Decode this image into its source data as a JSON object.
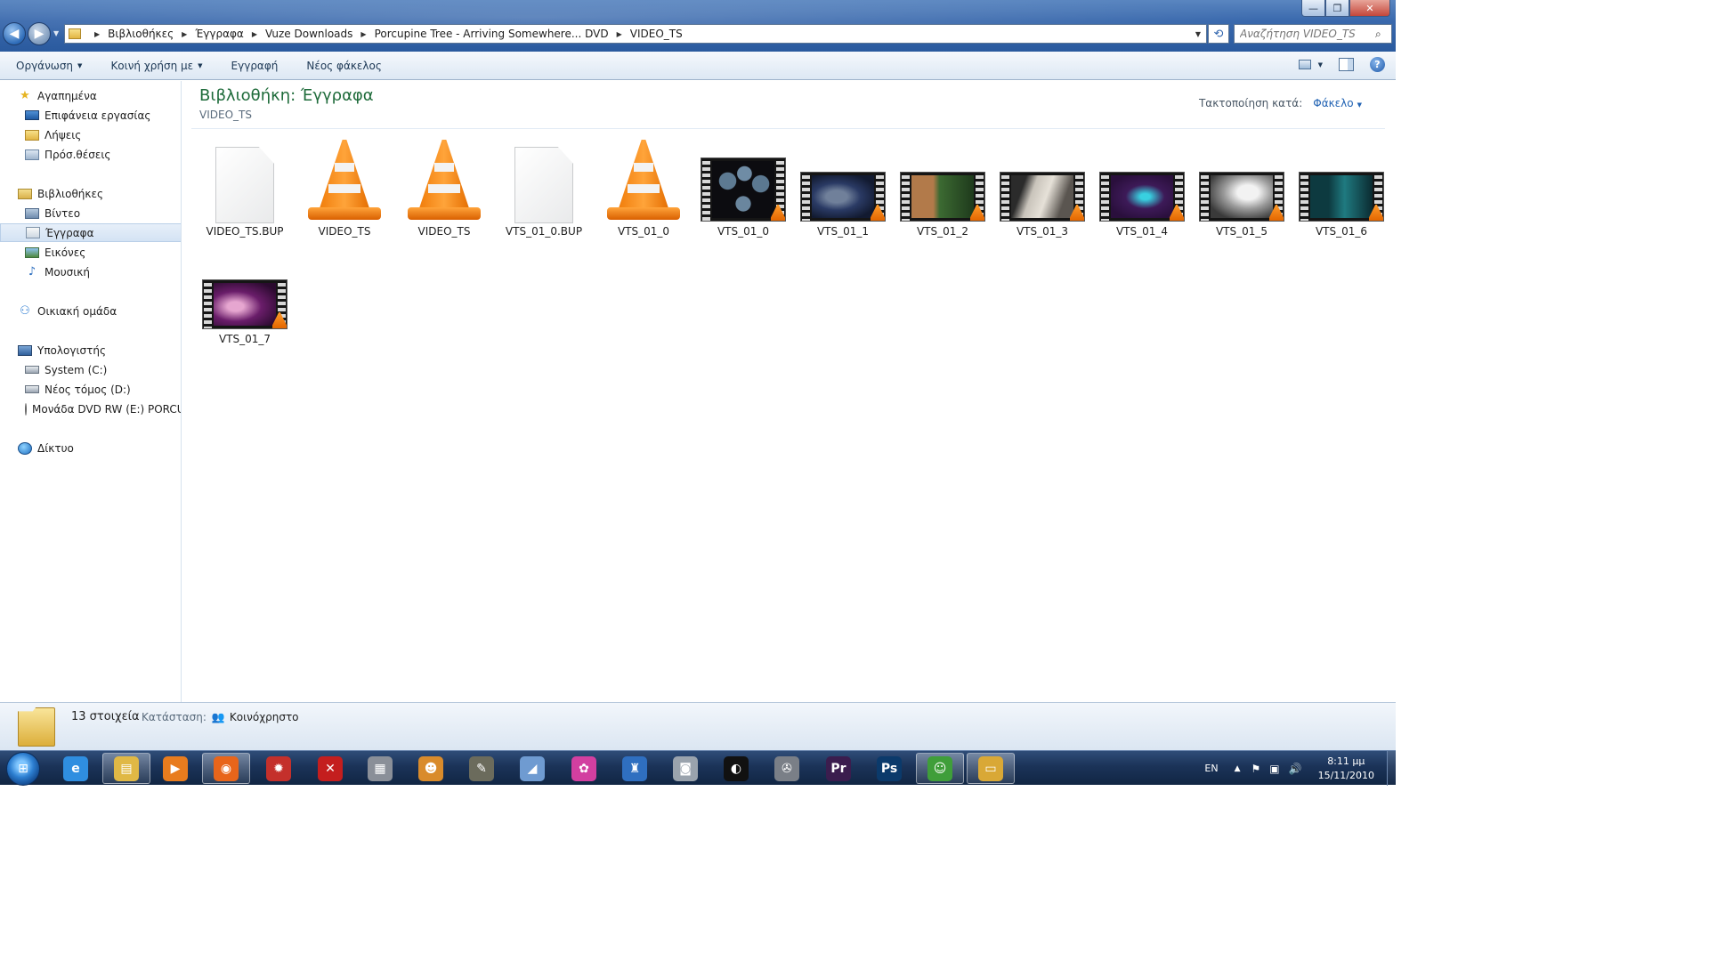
{
  "window": {
    "minimize_label": "—",
    "maximize_label": "❐",
    "close_label": "✕"
  },
  "address": {
    "crumbs": [
      "Βιβλιοθήκες",
      "Έγγραφα",
      "Vuze Downloads",
      "Porcupine Tree - Arriving Somewhere... DVD",
      "VIDEO_TS"
    ]
  },
  "search": {
    "placeholder": "Αναζήτηση VIDEO_TS"
  },
  "commandbar": {
    "organize": "Οργάνωση",
    "share_with": "Κοινή χρήση με",
    "burn": "Εγγραφή",
    "new_folder": "Νέος φάκελος"
  },
  "navpane": {
    "favorites": "Αγαπημένα",
    "desktop": "Επιφάνεια εργασίας",
    "downloads": "Λήψεις",
    "recent": "Πρόσ.θέσεις",
    "libraries": "Βιβλιοθήκες",
    "videos": "Βίντεο",
    "documents": "Έγγραφα",
    "pictures": "Εικόνες",
    "music": "Μουσική",
    "homegroup": "Οικιακή ομάδα",
    "computer": "Υπολογιστής",
    "drive_c": "System (C:)",
    "drive_d": "Νέος τόμος (D:)",
    "drive_e": "Μονάδα DVD RW (E:) PORCU",
    "network": "Δίκτυο"
  },
  "content": {
    "library_title": "Βιβλιοθήκη: Έγγραφα",
    "library_subtitle": "VIDEO_TS",
    "arrange_label": "Τακτοποίηση κατά:",
    "arrange_value": "Φάκελο",
    "files": [
      {
        "name": "VIDEO_TS.BUP",
        "kind": "blank"
      },
      {
        "name": "VIDEO_TS",
        "kind": "vlc"
      },
      {
        "name": "VIDEO_TS",
        "kind": "vlc"
      },
      {
        "name": "VTS_01_0.BUP",
        "kind": "blank"
      },
      {
        "name": "VTS_01_0",
        "kind": "vlc"
      },
      {
        "name": "VTS_01_0",
        "kind": "film-menu"
      },
      {
        "name": "VTS_01_1",
        "kind": "film"
      },
      {
        "name": "VTS_01_2",
        "kind": "film"
      },
      {
        "name": "VTS_01_3",
        "kind": "film"
      },
      {
        "name": "VTS_01_4",
        "kind": "film"
      },
      {
        "name": "VTS_01_5",
        "kind": "film"
      },
      {
        "name": "VTS_01_6",
        "kind": "film"
      },
      {
        "name": "VTS_01_7",
        "kind": "film"
      }
    ]
  },
  "details": {
    "count": "13 στοιχεία",
    "state_label": "Κατάσταση:",
    "state_value": "Κοινόχρηστο"
  },
  "taskbar": {
    "apps": [
      {
        "name": "internet-explorer",
        "glyph": "e",
        "color": "#2f8ee0"
      },
      {
        "name": "windows-explorer",
        "glyph": "▤",
        "color": "#e0b845"
      },
      {
        "name": "media-player",
        "glyph": "▶",
        "color": "#e87c1e"
      },
      {
        "name": "firefox",
        "glyph": "◉",
        "color": "#e8651a"
      },
      {
        "name": "app-red",
        "glyph": "✹",
        "color": "#c4302b"
      },
      {
        "name": "app-x",
        "glyph": "✕",
        "color": "#c41e1e"
      },
      {
        "name": "app-printer",
        "glyph": "▦",
        "color": "#8a8f98"
      },
      {
        "name": "app-face",
        "glyph": "☻",
        "color": "#d98b2b"
      },
      {
        "name": "app-gimp",
        "glyph": "✎",
        "color": "#6b6b5c"
      },
      {
        "name": "app-scanner",
        "glyph": "◢",
        "color": "#6f9bd1"
      },
      {
        "name": "app-pinwheel",
        "glyph": "✿",
        "color": "#d23fa0"
      },
      {
        "name": "app-castle",
        "glyph": "♜",
        "color": "#2f6fc0"
      },
      {
        "name": "app-camera",
        "glyph": "◙",
        "color": "#9aa3ad"
      },
      {
        "name": "app-live",
        "glyph": "◐",
        "color": "#111111"
      },
      {
        "name": "app-reel",
        "glyph": "✇",
        "color": "#7a7f87"
      },
      {
        "name": "premiere",
        "glyph": "Pr",
        "color": "#3b1d4e"
      },
      {
        "name": "photoshop",
        "glyph": "Ps",
        "color": "#0b3a6b"
      },
      {
        "name": "app-people",
        "glyph": "☺",
        "color": "#3f9e3a"
      },
      {
        "name": "app-window",
        "glyph": "▭",
        "color": "#d9a836"
      }
    ],
    "lang": "EN",
    "time": "8:11 μμ",
    "date": "15/11/2010"
  }
}
